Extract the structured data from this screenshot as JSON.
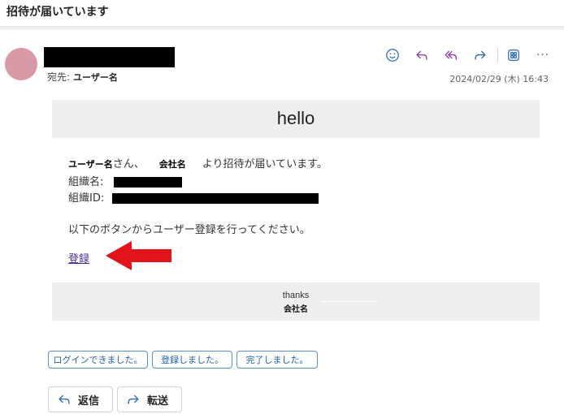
{
  "header": {
    "subject": "招待が届いています"
  },
  "message": {
    "to_label": "宛先:",
    "to_value": "ユーザー名",
    "timestamp": "2024/02/29 (木) 16:43"
  },
  "email_body": {
    "hello": "hello",
    "user_name": "ユーザー名",
    "san": "さん、",
    "company": "会社名",
    "invite_text": "より招待が届いています。",
    "org_name_label": "組織名:",
    "org_id_label": "組織ID:",
    "instruction": "以下のボタンからユーザー登録を行ってください。",
    "register_link": "登録",
    "thanks": "thanks",
    "footer_company": "会社名"
  },
  "quick_replies": [
    "ログインできました。",
    "登録しました。",
    "完了しました。"
  ],
  "actions": {
    "reply": "返信",
    "forward": "転送"
  },
  "colors": {
    "accent": "#2461a6",
    "avatar": "#d89aa6",
    "arrow": "#e3131b",
    "band": "#eeeeee"
  },
  "icons": [
    "emoji-icon",
    "reply-icon",
    "reply-all-icon",
    "forward-icon",
    "apps-icon",
    "more-icon"
  ]
}
